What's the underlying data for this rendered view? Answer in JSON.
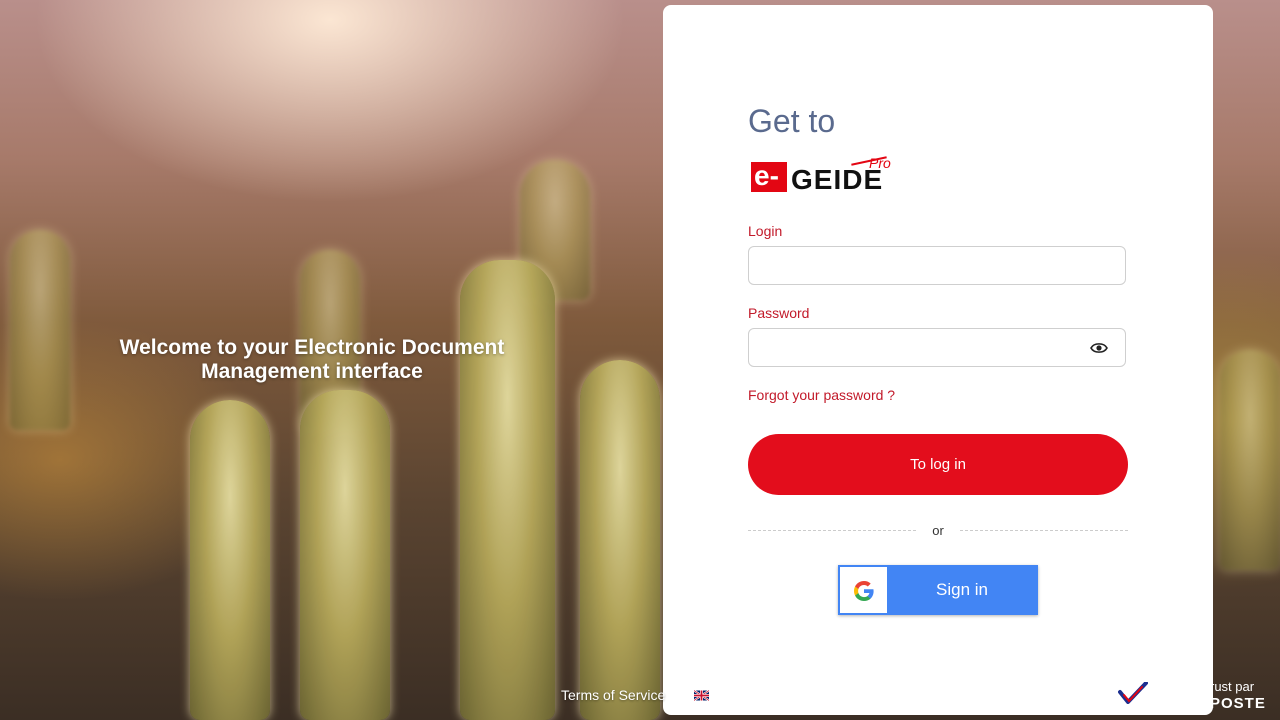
{
  "welcome": {
    "line1": "Welcome to your Electronic Document",
    "line2": "Management interface"
  },
  "card": {
    "heading": "Get to",
    "logo": {
      "e": "e-",
      "brand": "GEIDE",
      "pro": "Pro"
    },
    "login": {
      "label": "Login",
      "value": "",
      "placeholder": ""
    },
    "password": {
      "label": "Password",
      "value": "",
      "placeholder": "",
      "toggle_icon": "eye-icon"
    },
    "forgot_label": "Forgot your password ?",
    "login_button": "To log in",
    "separator": "or",
    "google_button": {
      "label": "Sign in",
      "icon": "google-icon"
    }
  },
  "footer": {
    "terms": "Terms of Service",
    "language_icon": "uk-flag-icon",
    "trust_text": "rust par",
    "poste_text": "POSTE"
  },
  "colors": {
    "accent_red": "#e30d1c",
    "label_red": "#c21a2a",
    "heading_blue": "#5a6a8e",
    "google_blue": "#4285f4"
  }
}
